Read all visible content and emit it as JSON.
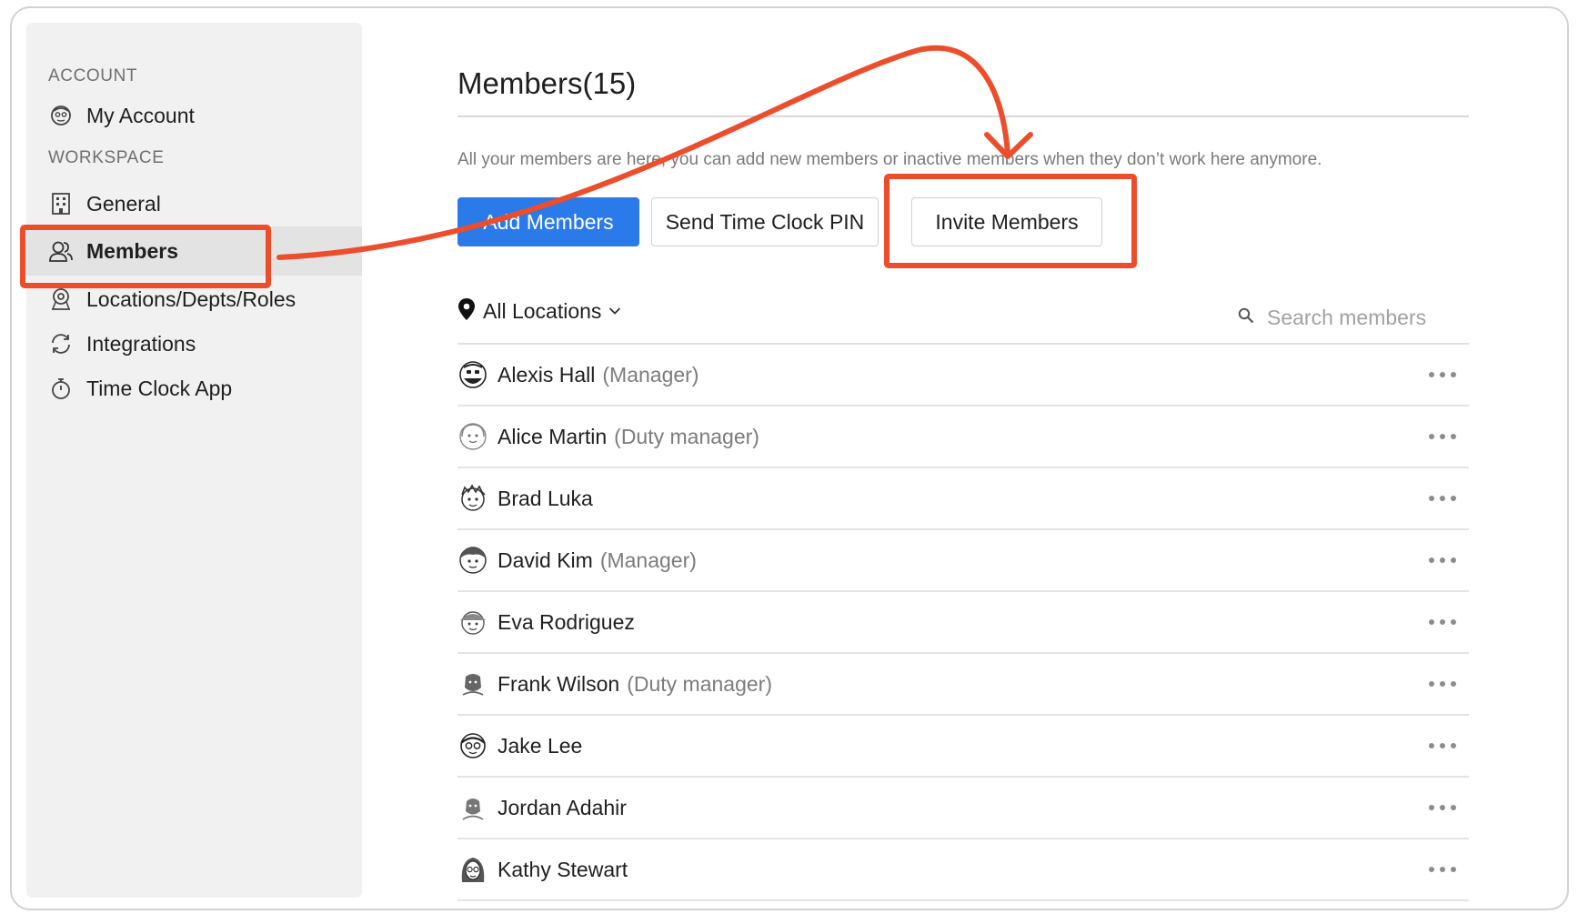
{
  "sidebar": {
    "account_label": "ACCOUNT",
    "workspace_label": "WORKSPACE",
    "items": [
      {
        "label": "My Account",
        "icon": "avatar-icon"
      },
      {
        "label": "General",
        "icon": "building-icon"
      },
      {
        "label": "Members",
        "icon": "users-icon",
        "active": true
      },
      {
        "label": "Locations/Depts/Roles",
        "icon": "location-icon"
      },
      {
        "label": "Integrations",
        "icon": "sync-icon"
      },
      {
        "label": "Time Clock App",
        "icon": "stopwatch-icon"
      }
    ]
  },
  "main": {
    "title": "Members(15)",
    "description": "All your members are here, you can add new members or inactive members when they don’t work here anymore.",
    "buttons": {
      "add": "Add Members",
      "send_pin": "Send Time Clock PIN",
      "invite": "Invite Members"
    },
    "filter": {
      "location": "All Locations",
      "search_placeholder": "Search members"
    },
    "members": [
      {
        "name": "Alexis Hall",
        "role": "(Manager)"
      },
      {
        "name": "Alice Martin",
        "role": "(Duty manager)"
      },
      {
        "name": "Brad Luka",
        "role": ""
      },
      {
        "name": "David Kim",
        "role": "(Manager)"
      },
      {
        "name": "Eva Rodriguez",
        "role": ""
      },
      {
        "name": "Frank Wilson",
        "role": "(Duty manager)"
      },
      {
        "name": "Jake Lee",
        "role": ""
      },
      {
        "name": "Jordan Adahir",
        "role": ""
      },
      {
        "name": "Kathy Stewart",
        "role": ""
      }
    ]
  },
  "annotation": {
    "color": "#ec4e2c"
  },
  "colors": {
    "primary": "#2a7ae9",
    "sidebar_bg": "#f1f1f1",
    "active_item": "#e3e3e3"
  }
}
